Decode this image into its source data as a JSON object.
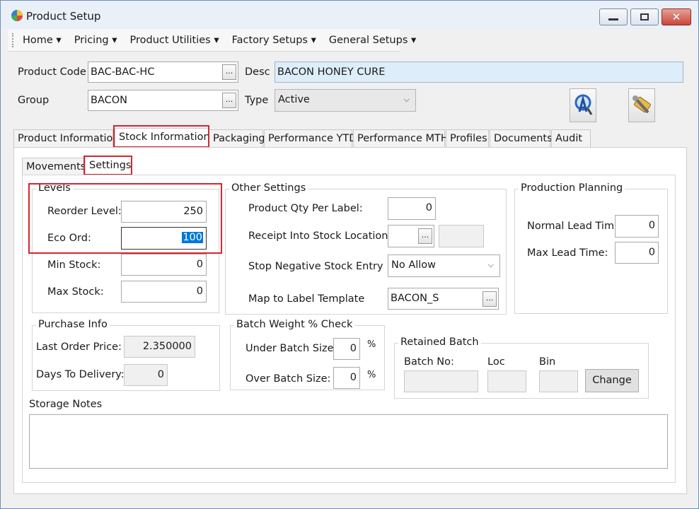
{
  "window": {
    "title": "Product Setup",
    "minimize_glyph": "▭",
    "maximize_glyph": "▢",
    "close_glyph": "✕"
  },
  "menu": [
    "Home",
    "Pricing",
    "Product Utilities",
    "Factory Setups",
    "General Setups"
  ],
  "header": {
    "product_code_label": "Product Code",
    "product_code_value": "BAC-BAC-HC",
    "desc_label": "Desc",
    "desc_value": "BACON HONEY CURE",
    "group_label": "Group",
    "group_value": "BACON",
    "type_label": "Type",
    "type_value": "Active",
    "ellipsis": "..."
  },
  "tabs": [
    "Product Information",
    "Stock Information",
    "Packaging",
    "Performance YTD",
    "Performance MTH",
    "Profiles",
    "Documents",
    "Audit"
  ],
  "active_tab": "Stock Information",
  "subtabs": [
    "Movements",
    "Settings"
  ],
  "active_subtab": "Settings",
  "levels": {
    "title": "Levels",
    "reorder_label": "Reorder Level:",
    "reorder_value": "250",
    "eco_label": "Eco Ord:",
    "eco_value": "100",
    "min_label": "Min Stock:",
    "min_value": "0",
    "max_label": "Max Stock:",
    "max_value": "0"
  },
  "other_settings": {
    "title": "Other Settings",
    "qty_label": "Product Qty Per Label:",
    "qty_value": "0",
    "receipt_label": "Receipt Into Stock Location",
    "receipt_value": "",
    "stop_neg_label": "Stop Negative Stock Entry",
    "stop_neg_value": "No Allow",
    "map_label": "Map to Label Template",
    "map_value": "BACON_S"
  },
  "production_planning": {
    "title": "Production Planning",
    "normal_label": "Normal Lead Time",
    "normal_value": "0",
    "max_label": "Max Lead Time:",
    "max_value": "0"
  },
  "purchase_info": {
    "title": "Purchase Info",
    "last_price_label": "Last Order Price:",
    "last_price_value": "2.350000",
    "days_label": "Days To Delivery:",
    "days_value": "0"
  },
  "batch_weight": {
    "title": "Batch Weight % Check",
    "under_label": "Under Batch Size:",
    "under_value": "0",
    "over_label": "Over Batch Size:",
    "over_value": "0",
    "percent": "%"
  },
  "retained_batch": {
    "title": "Retained Batch",
    "batch_label": "Batch No:",
    "loc_label": "Loc",
    "bin_label": "Bin",
    "change_label": "Change"
  },
  "storage_notes": {
    "label": "Storage Notes",
    "value": ""
  },
  "colors": {
    "highlight": "#d6262e",
    "desc_bg": "#ddeefa",
    "selection": "#0078d7"
  }
}
